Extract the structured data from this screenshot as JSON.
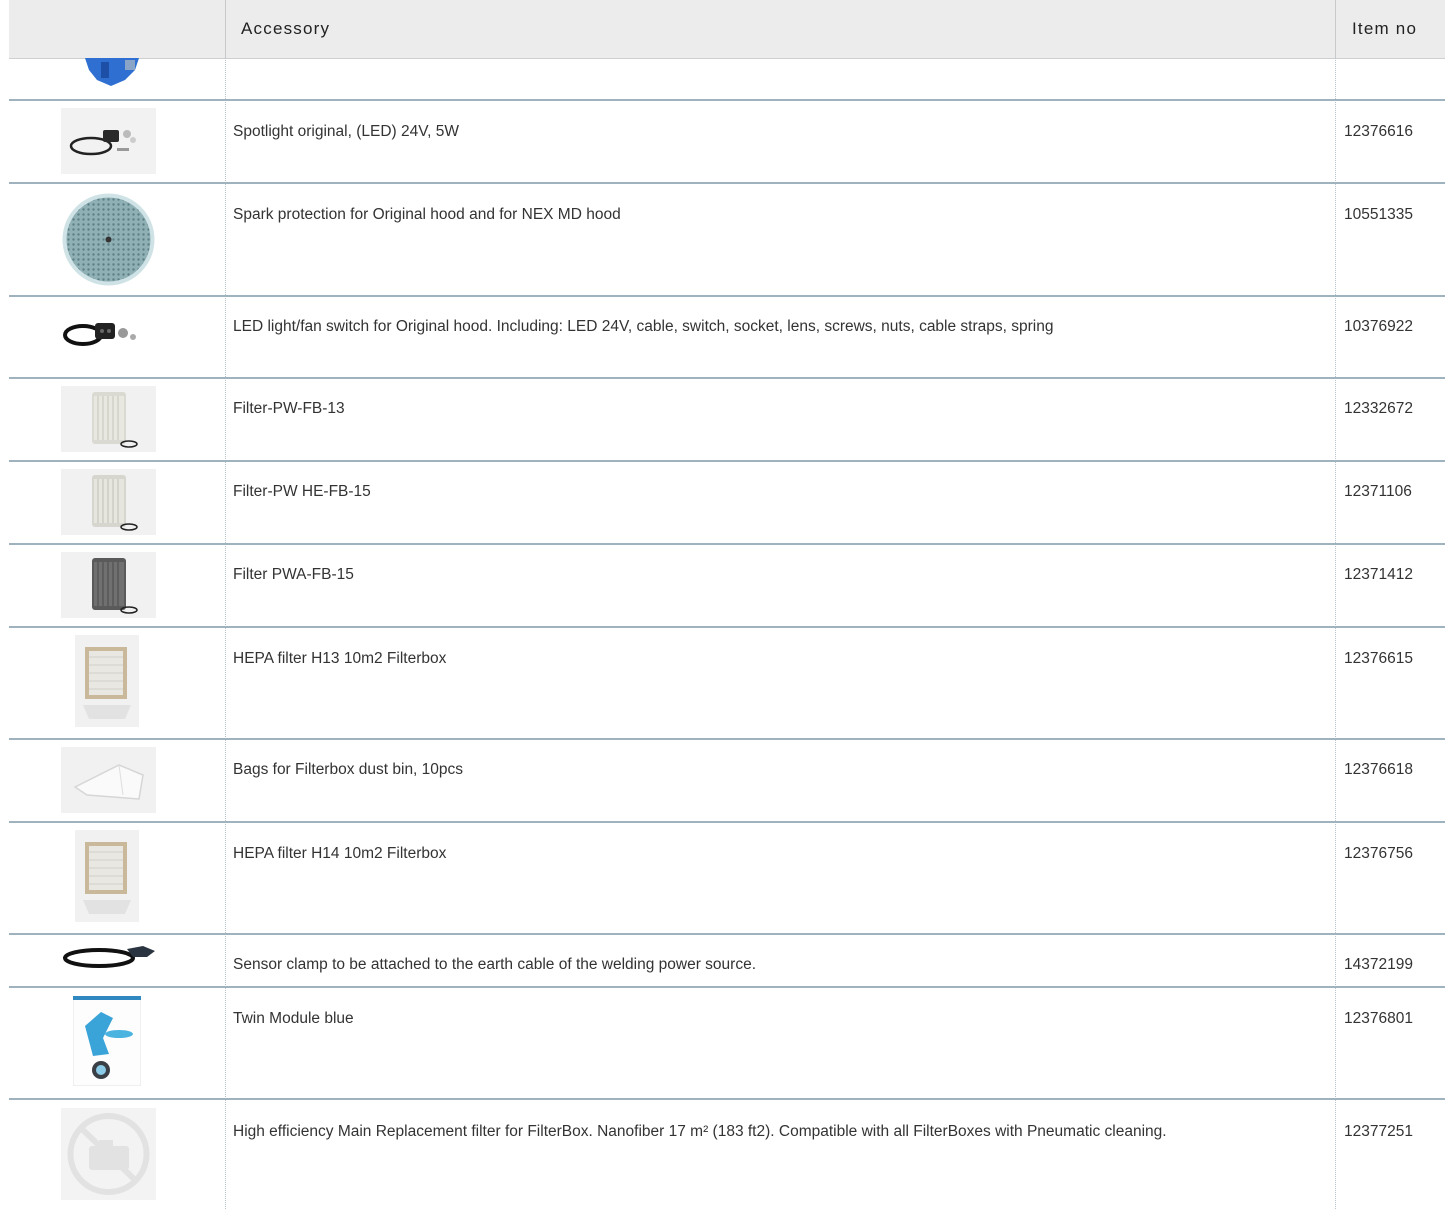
{
  "table": {
    "headers": {
      "accessory": "Accessory",
      "item_no": "Item no"
    },
    "rows": [
      {
        "desc": "",
        "item_no": "",
        "image": "blue-module-partial-icon"
      },
      {
        "desc": "Spotlight original, (LED) 24V, 5W",
        "item_no": "12376616",
        "image": "spotlight-icon"
      },
      {
        "desc": "Spark protection for Original hood and for NEX MD hood",
        "item_no": "10551335",
        "image": "spark-protection-icon"
      },
      {
        "desc": "LED light/fan switch for Original hood. Including: LED 24V, cable, switch, socket, lens, screws, nuts, cable straps, spring",
        "item_no": "10376922",
        "image": "led-switch-kit-icon"
      },
      {
        "desc": "Filter-PW-FB-13",
        "item_no": "12332672",
        "image": "cartridge-filter-icon"
      },
      {
        "desc": "Filter-PW HE-FB-15",
        "item_no": "12371106",
        "image": "cartridge-filter-icon"
      },
      {
        "desc": "Filter PWA-FB-15",
        "item_no": "12371412",
        "image": "carbon-filter-icon"
      },
      {
        "desc": "HEPA filter H13 10m2 Filterbox",
        "item_no": "12376615",
        "image": "hepa-filter-icon"
      },
      {
        "desc": "Bags for Filterbox dust bin, 10pcs",
        "item_no": "12376618",
        "image": "dust-bag-icon"
      },
      {
        "desc": "HEPA filter H14 10m2 Filterbox",
        "item_no": "12376756",
        "image": "hepa-filter-icon"
      },
      {
        "desc": "Sensor clamp to be attached to the earth cable of the welding power source.",
        "item_no": "14372199",
        "image": "sensor-clamp-icon"
      },
      {
        "desc": "Twin Module blue",
        "item_no": "12376801",
        "image": "twin-module-icon"
      },
      {
        "desc": "High efficiency Main Replacement filter for FilterBox. Nanofiber 17 m² (183 ft2). Compatible with all FilterBoxes with Pneumatic cleaning.",
        "item_no": "12377251",
        "image": "no-image-icon"
      }
    ]
  }
}
